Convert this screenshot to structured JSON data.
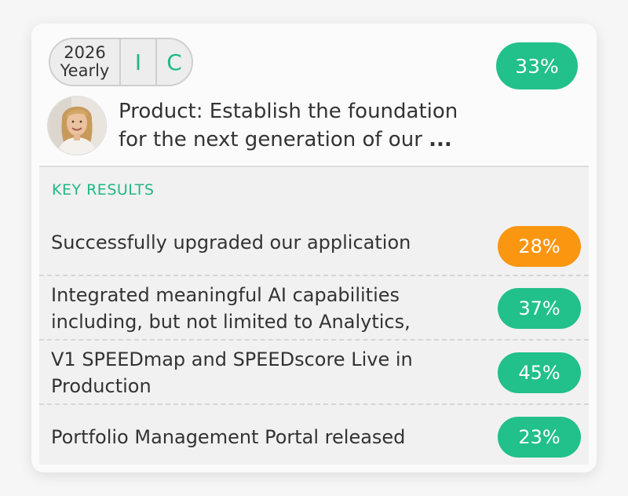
{
  "objective": {
    "period_year": "2026",
    "period_type": "Yearly",
    "tag_i": "I",
    "tag_c": "C",
    "progress_label": "33%",
    "progress_color": "#22c08a",
    "title_line1": "Product: Establish the foundation",
    "title_line2": "for the next generation of our",
    "title_ellipsis": "..."
  },
  "key_results": {
    "heading": "KEY RESULTS",
    "items": [
      {
        "line1": "Successfully upgraded our application",
        "line2": "",
        "progress": "28%",
        "color": "#fb9611"
      },
      {
        "line1": "Integrated meaningful AI capabilities",
        "line2": "including, but not limited to Analytics,",
        "progress": "37%",
        "color": "#22c08a"
      },
      {
        "line1": "V1 SPEEDmap and SPEEDscore Live in",
        "line2": "Production",
        "progress": "45%",
        "color": "#22c08a"
      },
      {
        "line1": "Portfolio Management Portal released",
        "line2": "",
        "progress": "23%",
        "color": "#22c08a"
      }
    ]
  },
  "icons": {
    "avatar": "user-avatar-photo"
  }
}
